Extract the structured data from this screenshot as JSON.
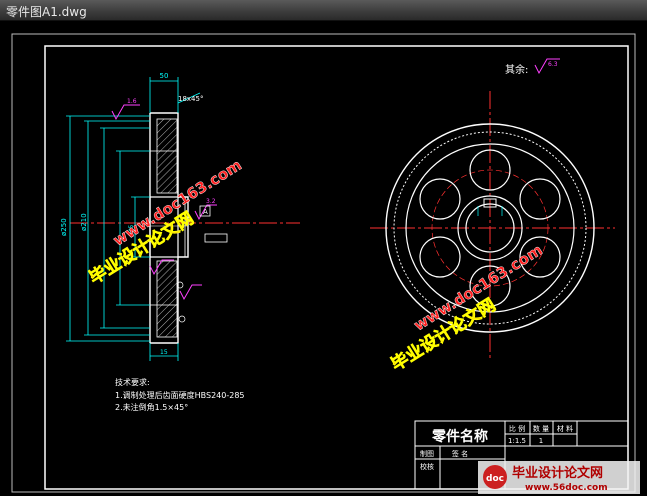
{
  "window": {
    "title": "零件图A1.dwg"
  },
  "drawing": {
    "dim_top": "50",
    "dim_chamfer": "18x45°",
    "dim_left_dia": "ø250",
    "dim_left2": "ø210",
    "dim_small": "ø45",
    "dim_bottom": "15",
    "datum_a": "A",
    "other_surfaces": "其余:",
    "roughness_other": "6.3",
    "roughness_a": "1.6",
    "roughness_b": "3.2",
    "tech_title": "技术要求:",
    "tech_line1": "1.调制处理后齿面硬度HBS240-285",
    "tech_line2": "2.未注倒角1.5×45°"
  },
  "title_block": {
    "part_name": "零件名称",
    "col_scale": "比 例",
    "col_qty": "数 量",
    "col_material": "材 料",
    "scale_value": "1:1.5",
    "qty_value": "1",
    "row_drawn": "制图",
    "row_checked": "校核",
    "drawn_by": "签 名"
  },
  "watermarks": {
    "site_cn": "毕业设计论文网",
    "site_url": "www.doc163.com",
    "corner_cn": "毕业设计论文网",
    "corner_url": "www.56doc.com"
  }
}
